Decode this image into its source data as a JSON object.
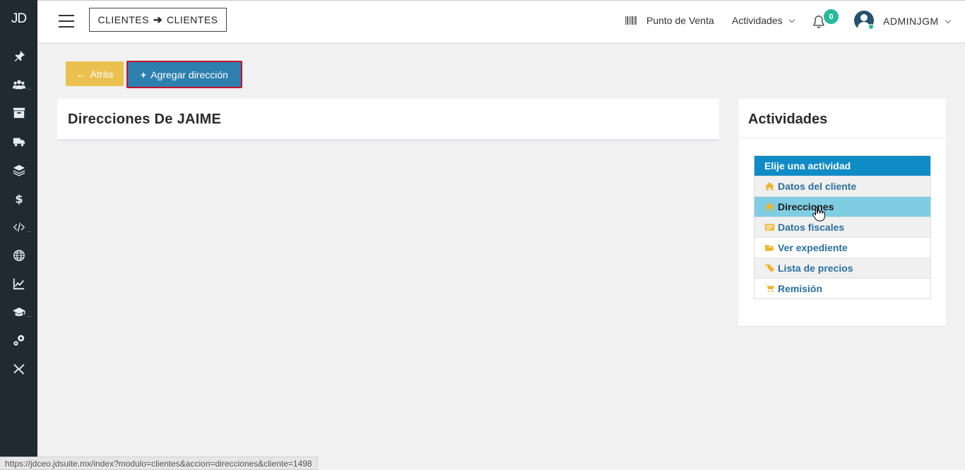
{
  "sidebar": {
    "logo": "JD",
    "items": [
      {
        "icon": "pin-icon"
      },
      {
        "icon": "users-icon"
      },
      {
        "icon": "archive-icon"
      },
      {
        "icon": "truck-icon"
      },
      {
        "icon": "layers-icon"
      },
      {
        "icon": "dollar-icon"
      },
      {
        "icon": "code-icon"
      },
      {
        "icon": "globe-icon"
      },
      {
        "icon": "chart-icon"
      },
      {
        "icon": "graduation-cap-icon"
      },
      {
        "icon": "settings-icon"
      },
      {
        "icon": "tools-icon"
      }
    ]
  },
  "topbar": {
    "breadcrumb_from": "CLIENTES",
    "breadcrumb_to": "CLIENTES",
    "pos_label": "Punto de Venta",
    "activities_label": "Actividades",
    "notifications_count": "0",
    "user_name": "ADMINJGM"
  },
  "actions": {
    "back_label": "Atrás",
    "back_icon": "←",
    "add_label": "Agregar dirección",
    "add_icon": "+"
  },
  "main": {
    "title": "Direcciones De JAIME"
  },
  "side_panel": {
    "title": "Actividades",
    "list_header": "Elije una actividad",
    "items": [
      {
        "label": "Datos del cliente",
        "icon": "home-icon"
      },
      {
        "label": "Direcciones",
        "icon": "home-icon",
        "active": true
      },
      {
        "label": "Datos fiscales",
        "icon": "id-card-icon"
      },
      {
        "label": "Ver expediente",
        "icon": "folder-icon"
      },
      {
        "label": "Lista de precios",
        "icon": "tags-icon"
      },
      {
        "label": "Remisión",
        "icon": "cart-icon"
      }
    ]
  },
  "status_bar": {
    "url": "https://jdceo.jdsuite.mx/index?modulo=clientes&accion=direcciones&cliente=1498"
  },
  "colors": {
    "sidebar_bg": "#1f2a33",
    "back_button": "#eac04f",
    "add_button": "#2d7fae",
    "list_header": "#0f8bc6",
    "active_item": "#7fcde2",
    "badge": "#26b99a"
  }
}
